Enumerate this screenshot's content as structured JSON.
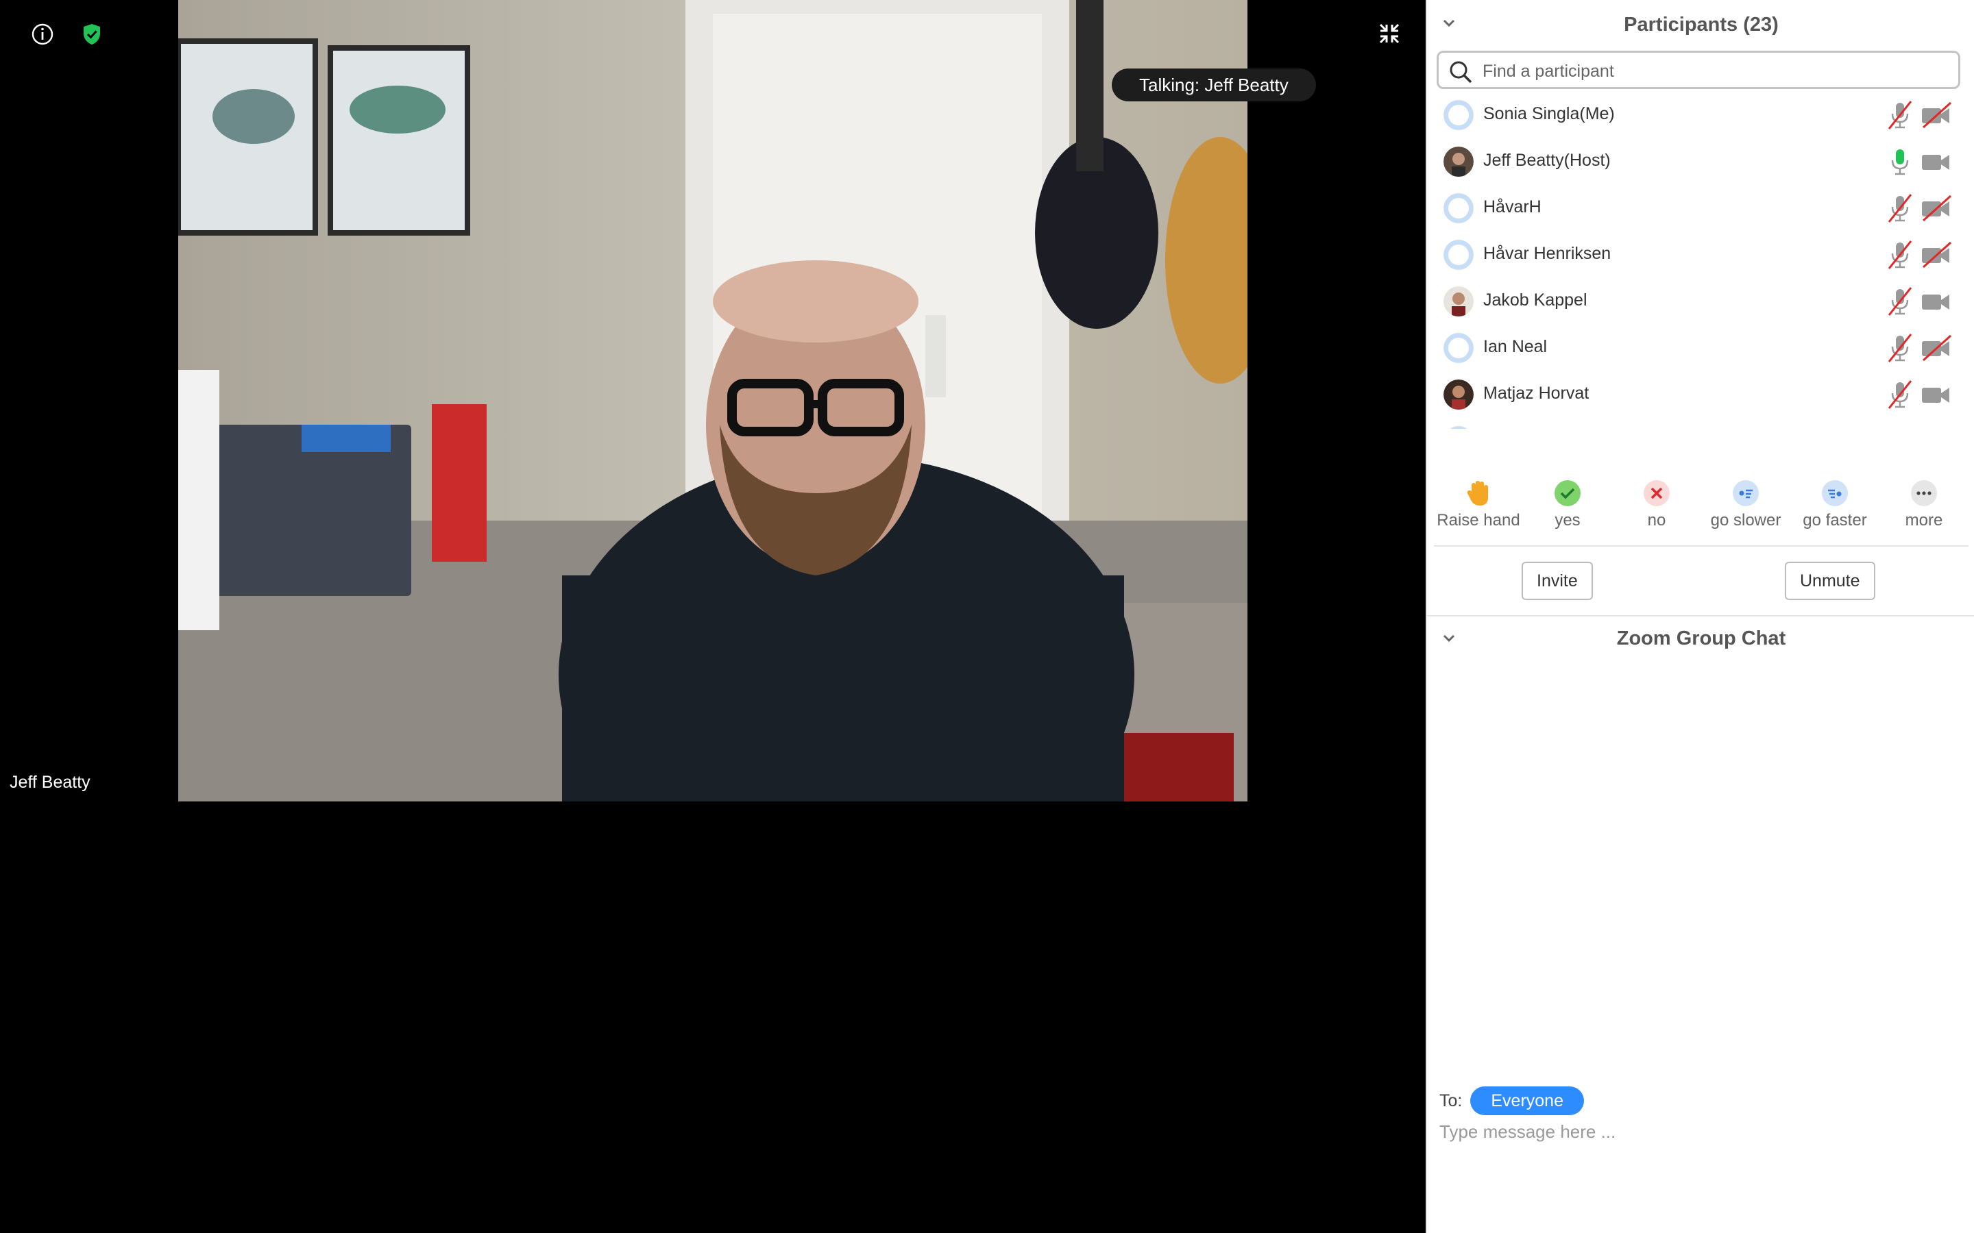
{
  "video": {
    "talking_indicator": "Talking: Jeff Beatty",
    "speaker_name": "Jeff Beatty"
  },
  "participants": {
    "title": "Participants (23)",
    "search_placeholder": "Find a participant",
    "list": [
      {
        "name": "Sonia Singla(Me)",
        "mic": "muted",
        "video": "off"
      },
      {
        "name": "Jeff Beatty(Host)",
        "mic": "on",
        "video": "on"
      },
      {
        "name": "HåvarH",
        "mic": "muted",
        "video": "off"
      },
      {
        "name": "Håvar Henriksen",
        "mic": "muted",
        "video": "off"
      },
      {
        "name": "Jakob Kappel",
        "mic": "muted",
        "video": "on"
      },
      {
        "name": "Ian Neal",
        "mic": "muted",
        "video": "off"
      },
      {
        "name": "Matjaz Horvat",
        "mic": "muted",
        "video": "on"
      }
    ],
    "reactions": [
      {
        "label": "Raise hand",
        "icon": "raise-hand-icon"
      },
      {
        "label": "yes",
        "icon": "check-icon"
      },
      {
        "label": "no",
        "icon": "x-icon"
      },
      {
        "label": "go slower",
        "icon": "go-slower-icon"
      },
      {
        "label": "go faster",
        "icon": "go-faster-icon"
      },
      {
        "label": "more",
        "icon": "more-icon"
      }
    ],
    "invite_label": "Invite",
    "unmute_label": "Unmute"
  },
  "chat": {
    "title": "Zoom Group Chat",
    "to_label": "To:",
    "recipient": "Everyone",
    "input_placeholder": "Type message here ..."
  },
  "colors": {
    "accent": "#2d8cff",
    "shield": "#23c257",
    "mic_on": "#23c257",
    "muted": "#e02828"
  }
}
